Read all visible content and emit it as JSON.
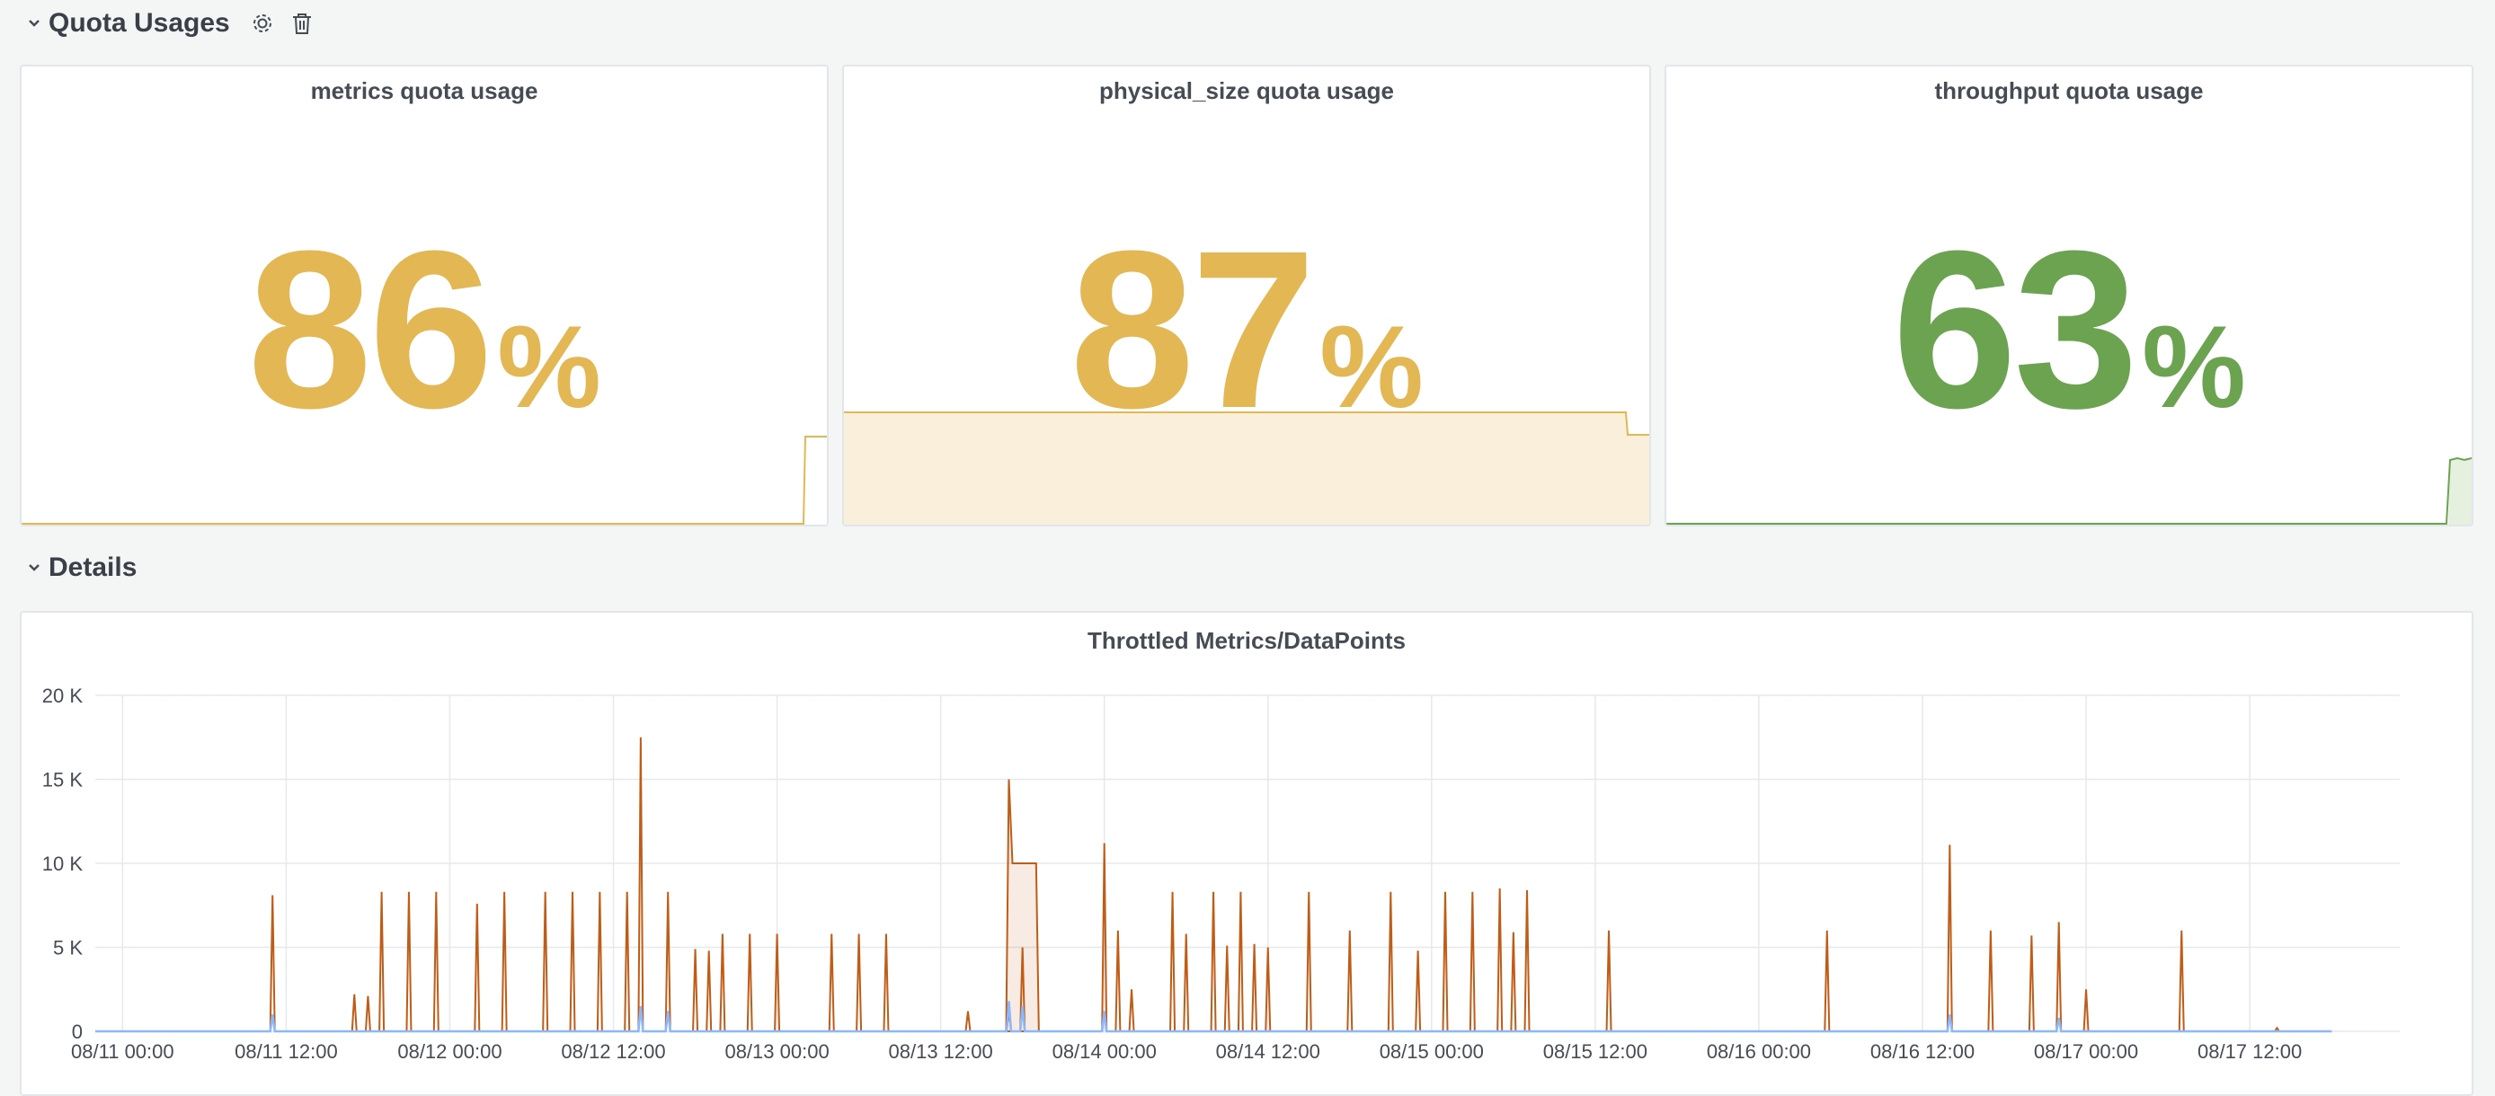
{
  "rows": {
    "quota": {
      "title": "Quota Usages",
      "icons": [
        "chevron-down-icon",
        "gear-icon",
        "trash-icon"
      ]
    },
    "details": {
      "title": "Details",
      "icons": [
        "chevron-down-icon"
      ]
    }
  },
  "stats": [
    {
      "title": "metrics quota usage",
      "value": "86",
      "unit": "%",
      "color": "#e2b754"
    },
    {
      "title": "physical_size quota usage",
      "value": "87",
      "unit": "%",
      "color": "#e2b754",
      "fill": "#faefdb"
    },
    {
      "title": "throughput quota usage",
      "value": "63",
      "unit": "%",
      "color": "#6ba350",
      "fill": "#e6f0df"
    }
  ],
  "chart_data": {
    "type": "line",
    "title": "Throttled Metrics/DataPoints",
    "xlabel": "",
    "ylabel": "",
    "ylim": [
      0,
      20000
    ],
    "y_ticks": [
      "0",
      "5 K",
      "10 K",
      "15 K",
      "20 K"
    ],
    "x_ticks": [
      "08/11 00:00",
      "08/11 12:00",
      "08/12 00:00",
      "08/12 12:00",
      "08/13 00:00",
      "08/13 12:00",
      "08/14 00:00",
      "08/14 12:00",
      "08/15 00:00",
      "08/15 12:00",
      "08/16 00:00",
      "08/16 12:00",
      "08/17 00:00",
      "08/17 12:00"
    ],
    "x_unit": "hours since 08/11 00:00",
    "xlim": [
      -2,
      167
    ],
    "grid": true,
    "series": [
      {
        "color": "#c15c17",
        "spikes": [
          [
            11,
            8100
          ],
          [
            17,
            2200
          ],
          [
            18,
            2100
          ],
          [
            19,
            8300
          ],
          [
            21,
            8300
          ],
          [
            23,
            8300
          ],
          [
            26,
            7600
          ],
          [
            28,
            8300
          ],
          [
            31,
            8300
          ],
          [
            33,
            8300
          ],
          [
            35,
            8300
          ],
          [
            37,
            8300
          ],
          [
            38,
            17500
          ],
          [
            40,
            8300
          ],
          [
            42,
            4900
          ],
          [
            43,
            4800
          ],
          [
            44,
            5800
          ],
          [
            46,
            5800
          ],
          [
            48,
            5800
          ],
          [
            52,
            5800
          ],
          [
            54,
            5800
          ],
          [
            56,
            5800
          ],
          [
            62,
            1200
          ],
          [
            65,
            1200
          ],
          [
            66,
            5000
          ],
          [
            72,
            11200
          ],
          [
            73,
            6000
          ],
          [
            74,
            2500
          ],
          [
            77,
            8300
          ],
          [
            78,
            5800
          ],
          [
            80,
            8300
          ],
          [
            81,
            5100
          ],
          [
            82,
            8300
          ],
          [
            83,
            5200
          ],
          [
            84,
            5000
          ],
          [
            87,
            8300
          ],
          [
            90,
            6000
          ],
          [
            93,
            8300
          ],
          [
            95,
            4800
          ],
          [
            97,
            8300
          ],
          [
            99,
            8300
          ],
          [
            101,
            8500
          ],
          [
            102,
            5900
          ],
          [
            103,
            8400
          ],
          [
            109,
            6000
          ],
          [
            125,
            6000
          ],
          [
            134,
            11100
          ],
          [
            137,
            6000
          ],
          [
            140,
            5700
          ],
          [
            142,
            6500
          ],
          [
            144,
            2500
          ],
          [
            151,
            6000
          ],
          [
            158,
            200
          ]
        ],
        "bumps": [
          {
            "from": 65,
            "to": 67,
            "peak": 15000,
            "plateau": 10000
          }
        ]
      },
      {
        "color": "#8ab8ff",
        "spikes": [
          [
            11,
            1000
          ],
          [
            38,
            1500
          ],
          [
            40,
            1200
          ],
          [
            65,
            1800
          ],
          [
            66,
            1500
          ],
          [
            72,
            1200
          ],
          [
            134,
            1000
          ],
          [
            142,
            800
          ]
        ]
      }
    ]
  }
}
